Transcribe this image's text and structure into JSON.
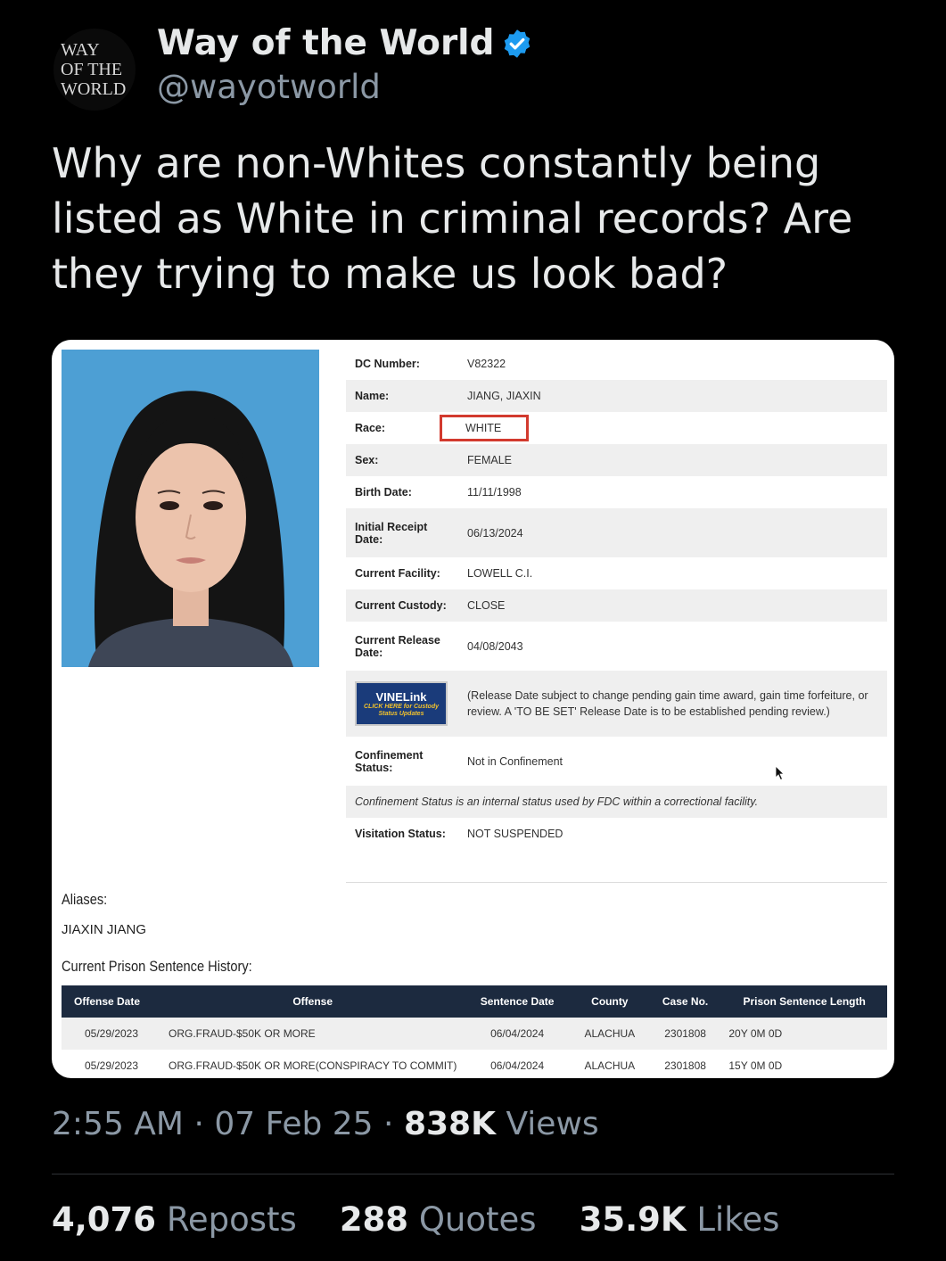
{
  "author": {
    "avatar_lines": [
      "WAY",
      "OF THE",
      "WORLD"
    ],
    "display_name": "Way of the World",
    "handle": "@wayotworld",
    "verified_icon": "verified-badge-icon",
    "verified_color": "#1d9bf0"
  },
  "tweet": {
    "text": "Why are non-Whites constantly being listed as White in criminal records? Are they trying to make us look bad?"
  },
  "record": {
    "rows": [
      {
        "label": "DC Number:",
        "value": "V82322"
      },
      {
        "label": "Name:",
        "value": "JIANG, JIAXIN"
      },
      {
        "label": "Race:",
        "value": "WHITE"
      },
      {
        "label": "Sex:",
        "value": "FEMALE"
      },
      {
        "label": "Birth Date:",
        "value": "11/11/1998"
      },
      {
        "label": "Initial Receipt Date:",
        "value": "06/13/2024"
      },
      {
        "label": "Current Facility:",
        "value": "LOWELL C.I."
      },
      {
        "label": "Current Custody:",
        "value": "CLOSE"
      },
      {
        "label": "Current Release Date:",
        "value": "04/08/2043"
      },
      {
        "label": "Confinement Status:",
        "value": "Not in Confinement"
      },
      {
        "label": "Visitation Status:",
        "value": "NOT SUSPENDED"
      }
    ],
    "vine": {
      "logo": "VINELink",
      "sub": "CLICK HERE for Custody Status Updates",
      "note": "(Release Date subject to change pending gain time award, gain time forfeiture, or review. A 'TO BE SET' Release Date is to be established pending review.)"
    },
    "confinement_note": "Confinement Status is an internal status used by FDC within a correctional facility.",
    "aliases_title": "Aliases:",
    "alias": "JIAXIN JIANG",
    "sentence_title": "Current Prison Sentence History:",
    "sentence_headers": [
      "Offense Date",
      "Offense",
      "Sentence Date",
      "County",
      "Case No.",
      "Prison Sentence Length"
    ],
    "sentences": [
      [
        "05/29/2023",
        "ORG.FRAUD-$50K OR MORE",
        "06/04/2024",
        "ALACHUA",
        "2301808",
        "20Y 0M 0D"
      ],
      [
        "05/29/2023",
        "ORG.FRAUD-$50K OR MORE(CONSPIRACY TO COMMIT)",
        "06/04/2024",
        "ALACHUA",
        "2301808",
        "15Y 0M 0D"
      ]
    ],
    "highlight_color": "#d23a2e"
  },
  "meta": {
    "time": "2:55 AM",
    "date": "07 Feb 25",
    "views_count": "838K",
    "views_label": "Views",
    "separator": "·"
  },
  "stats": {
    "reposts_count": "4,076",
    "reposts_label": "Reposts",
    "quotes_count": "288",
    "quotes_label": "Quotes",
    "likes_count": "35.9K",
    "likes_label": "Likes"
  }
}
